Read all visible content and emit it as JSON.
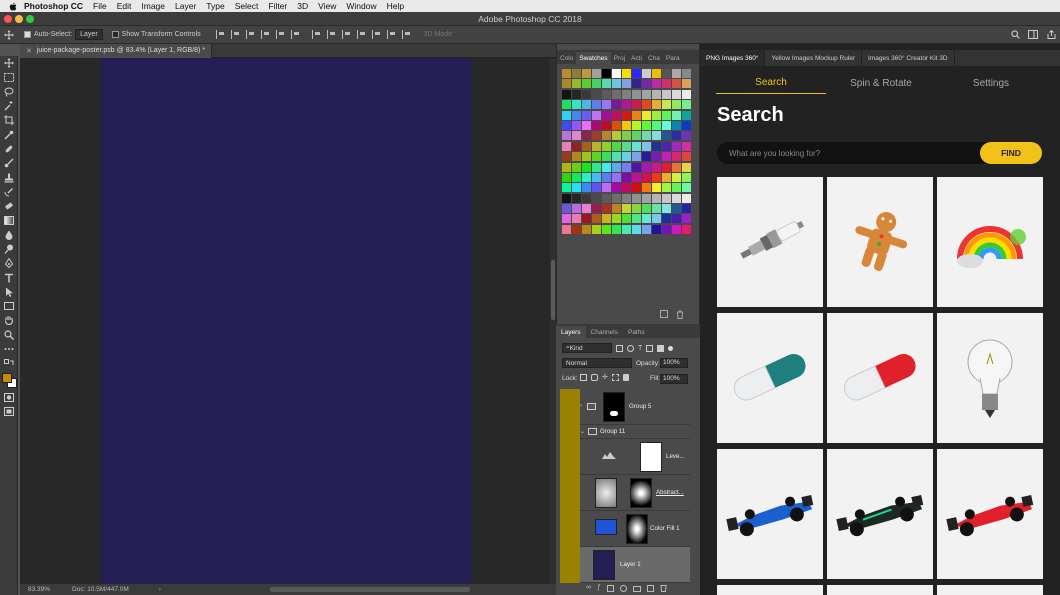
{
  "menubar": {
    "app_name": "Photoshop CC",
    "items": [
      "File",
      "Edit",
      "Image",
      "Layer",
      "Type",
      "Select",
      "Filter",
      "3D",
      "View",
      "Window",
      "Help"
    ]
  },
  "window": {
    "title": "Adobe Photoshop CC 2018"
  },
  "options": {
    "auto_select_label": "Auto-Select:",
    "auto_select_value": "Layer",
    "transform_label": "Show Transform Controls",
    "mode_3d_label": "3D Mode:"
  },
  "document": {
    "tab_label": "juice-package-poster.psb @ 83.4% (Layer 1, RGB/8) *",
    "zoom": "83.39%",
    "doc_size": "Doc: 10.5M/447.0M",
    "artboard_color": "#231e53"
  },
  "swatches_panel": {
    "tabs": [
      "Colo",
      "Swatches",
      "Proj",
      "Acti",
      "Cha",
      "Para"
    ],
    "active_tab": "Swatches"
  },
  "layers_panel": {
    "tabs": [
      "Layers",
      "Channels",
      "Paths"
    ],
    "kind_label": "Kind",
    "blend_mode": "Normal",
    "opacity_label": "Opacity:",
    "opacity_value": "100%",
    "lock_label": "Lock:",
    "fill_label": "Fill:",
    "fill_value": "100%",
    "layers": [
      {
        "name": "Group 5"
      },
      {
        "name": "Group 11"
      },
      {
        "name": "Leve..."
      },
      {
        "name": "Abstract..."
      },
      {
        "name": "Color Fill 1"
      },
      {
        "name": "Layer 1"
      }
    ]
  },
  "plugin": {
    "tabs": [
      "PNG Images 360°",
      "Yellow Images Mockup Ruler",
      "Images 360° Creator Kit 3D"
    ],
    "subnav": [
      "Search",
      "Spin & Rotate",
      "Settings"
    ],
    "title": "Search",
    "search_placeholder": "What are you looking for?",
    "find_label": "FIND",
    "accent": "#f2c21a",
    "results": [
      {
        "icon": "spark-plug-icon"
      },
      {
        "icon": "gingerbread-man-icon"
      },
      {
        "icon": "rainbow-icon"
      },
      {
        "icon": "teal-capsule-icon"
      },
      {
        "icon": "red-capsule-icon"
      },
      {
        "icon": "light-bulb-icon"
      },
      {
        "icon": "blue-race-car-icon"
      },
      {
        "icon": "green-race-car-icon"
      },
      {
        "icon": "red-race-car-icon"
      }
    ]
  }
}
